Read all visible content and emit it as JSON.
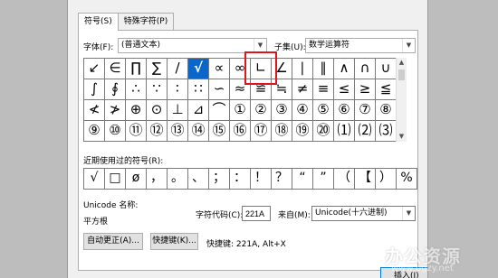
{
  "tabs": [
    "符号(S)",
    "特殊字符(P)"
  ],
  "font": {
    "label": "字体(F):",
    "value": "(普通文本)"
  },
  "subset": {
    "label": "子集(U):",
    "value": "数学运算符"
  },
  "symbols": [
    "↙",
    "∈",
    "∏",
    "∑",
    "/",
    "√",
    "∝",
    "∞",
    "∟",
    "∠",
    "∣",
    "∥",
    "∧",
    "∩",
    "∪",
    "∫",
    "∮",
    "∴",
    "∵",
    "∶",
    "∷",
    "∽",
    "≈",
    "≌",
    "≒",
    "≠",
    "≡",
    "≤",
    "≥",
    "≦",
    "≮",
    "≯",
    "⊕",
    "⊙",
    "⊥",
    "⊿",
    "⌒",
    "①",
    "②",
    "③",
    "④",
    "⑤",
    "⑥",
    "⑦",
    "⑧",
    "⑨",
    "⑩",
    "⑪",
    "⑫",
    "⑬",
    "⑭",
    "⑮",
    "⑯",
    "⑰",
    "⑱",
    "⑲",
    "⑳",
    "⑴",
    "⑵",
    "⑶"
  ],
  "selected_symbol": "√",
  "recent": {
    "label": "近期使用过的符号(R):",
    "items": [
      "√",
      "□",
      "ø",
      "，",
      "。",
      "、",
      "；",
      "：",
      "！",
      "？",
      "“",
      "”",
      "（",
      "【",
      "）",
      "%"
    ]
  },
  "unicode_name": {
    "label": "Unicode 名称:",
    "value": "平方根"
  },
  "char_code": {
    "label": "字符代码(C):",
    "value": "221A"
  },
  "from": {
    "label": "来自(M):",
    "value": "Unicode(十六进制)"
  },
  "buttons": {
    "autocorrect": "自动更正(A)...",
    "shortcut": "快捷键(K)...",
    "insert": "插入(I)"
  },
  "shortcut_text": "快捷键: 221A, Alt+X",
  "watermark": "办公资源",
  "watermark2": "www.bgzy.net"
}
